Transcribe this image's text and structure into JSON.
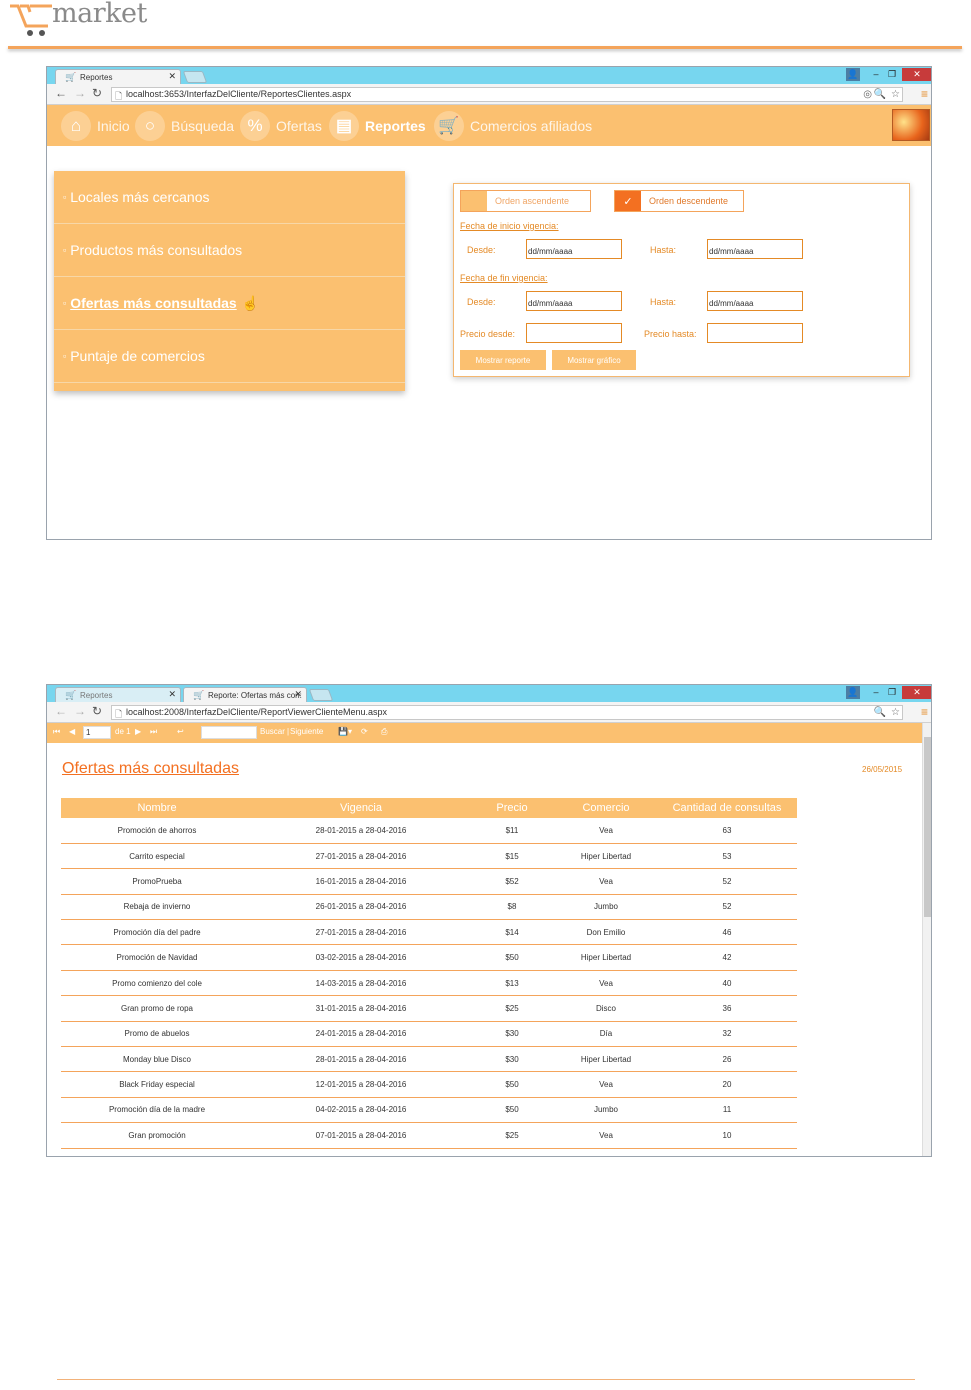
{
  "doc": {
    "logo_text": "market"
  },
  "browser1": {
    "tab_title": "Reportes",
    "url": "localhost:3653/InterfazDelCliente/ReportesClientes.aspx",
    "nav": [
      {
        "label": "Inicio",
        "icon": "home-icon"
      },
      {
        "label": "Búsqueda",
        "icon": "search-icon"
      },
      {
        "label": "Ofertas",
        "icon": "percent-icon"
      },
      {
        "label": "Reportes",
        "icon": "clipboard-icon"
      },
      {
        "label": "Comercios afiliados",
        "icon": "cart-icon"
      }
    ],
    "report_menu": [
      {
        "label": "Locales más cercanos"
      },
      {
        "label": "Productos más consultados"
      },
      {
        "label": "Ofertas más consultadas"
      },
      {
        "label": "Puntaje de comercios"
      }
    ],
    "filters": {
      "order_asc": "Orden ascendente",
      "order_desc": "Orden descendente",
      "start_validity": "Fecha de inicio vigencia:",
      "end_validity": "Fecha de fin vigencia:",
      "from": "Desde:",
      "to": "Hasta:",
      "date_placeholder": "dd/mm/aaaa",
      "price_from": "Precio desde:",
      "price_to": "Precio hasta:",
      "show_report": "Mostrar reporte",
      "show_chart": "Mostrar gráfico"
    }
  },
  "browser2": {
    "tab1_title": "Reportes",
    "tab2_title": "Reporte: Ofertas más con:",
    "url": "localhost:2008/InterfazDelCliente/ReportViewerClienteMenu.aspx",
    "toolbar": {
      "page_value": "1",
      "page_of": "de 1",
      "find": "Buscar",
      "next": "Siguiente"
    },
    "report": {
      "title": "Ofertas más consultadas",
      "date": "26/05/2015",
      "columns": [
        "Nombre",
        "Vigencia",
        "Precio",
        "Comercio",
        "Cantidad de consultas"
      ],
      "rows": [
        [
          "Promoción de ahorros",
          "28-01-2015 a 28-04-2016",
          "$11",
          "Vea",
          "63"
        ],
        [
          "Carrito especial",
          "27-01-2015 a 28-04-2016",
          "$15",
          "Hiper Libertad",
          "53"
        ],
        [
          "PromoPrueba",
          "16-01-2015 a 28-04-2016",
          "$52",
          "Vea",
          "52"
        ],
        [
          "Rebaja de invierno",
          "26-01-2015 a 28-04-2016",
          "$8",
          "Jumbo",
          "52"
        ],
        [
          "Promoción día del padre",
          "27-01-2015 a 28-04-2016",
          "$14",
          "Don Emilio",
          "46"
        ],
        [
          "Promoción de Navidad",
          "03-02-2015 a 28-04-2016",
          "$50",
          "Hiper Libertad",
          "42"
        ],
        [
          "Promo comienzo del cole",
          "14-03-2015 a 28-04-2016",
          "$13",
          "Vea",
          "40"
        ],
        [
          "Gran promo de ropa",
          "31-01-2015 a 28-04-2016",
          "$25",
          "Disco",
          "36"
        ],
        [
          "Promo de abuelos",
          "24-01-2015 a 28-04-2016",
          "$30",
          "Día",
          "32"
        ],
        [
          "Monday blue Disco",
          "28-01-2015 a 28-04-2016",
          "$30",
          "Hiper Libertad",
          "26"
        ],
        [
          "Black Friday especial",
          "12-01-2015 a 28-04-2016",
          "$50",
          "Vea",
          "20"
        ],
        [
          "Promoción día de la madre",
          "04-02-2015 a 28-04-2016",
          "$50",
          "Jumbo",
          "11"
        ],
        [
          "Gran promoción",
          "07-01-2015 a 28-04-2016",
          "$25",
          "Vea",
          "10"
        ]
      ]
    }
  },
  "colors": {
    "accent": "#fbc070",
    "accent_dark": "#f37021",
    "titlebar": "#77d6ef"
  }
}
